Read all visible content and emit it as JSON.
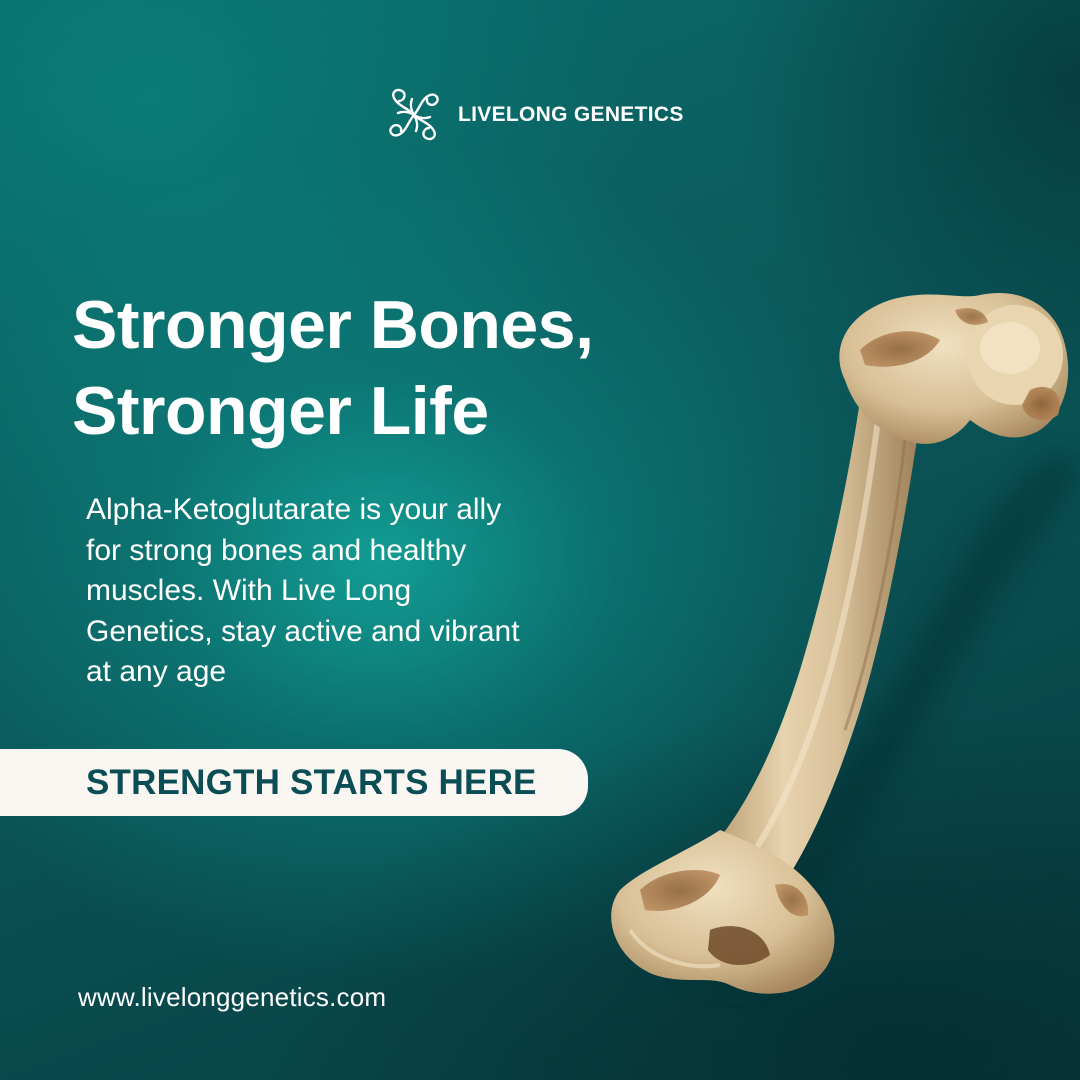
{
  "brand": {
    "name": "LIVELONG GENETICS",
    "logo_icon": "looped-flower-logo"
  },
  "headline": {
    "line1": "Stronger Bones,",
    "line2": "Stronger Life"
  },
  "body": {
    "text": "Alpha-Ketoglutarate is your ally for strong bones and healthy muscles. With Live Long Genetics, stay active and vibrant at any age"
  },
  "cta": {
    "label": "STRENGTH STARTS HERE"
  },
  "footer": {
    "website": "www.livelonggenetics.com"
  },
  "image": {
    "subject": "femur-bone"
  },
  "colors": {
    "background_teal": "#0a6b6a",
    "background_dark": "#063c40",
    "cta_background": "#faf7f2",
    "cta_text": "#0b4d55",
    "bone": "#d9c39c",
    "text": "#ffffff"
  }
}
